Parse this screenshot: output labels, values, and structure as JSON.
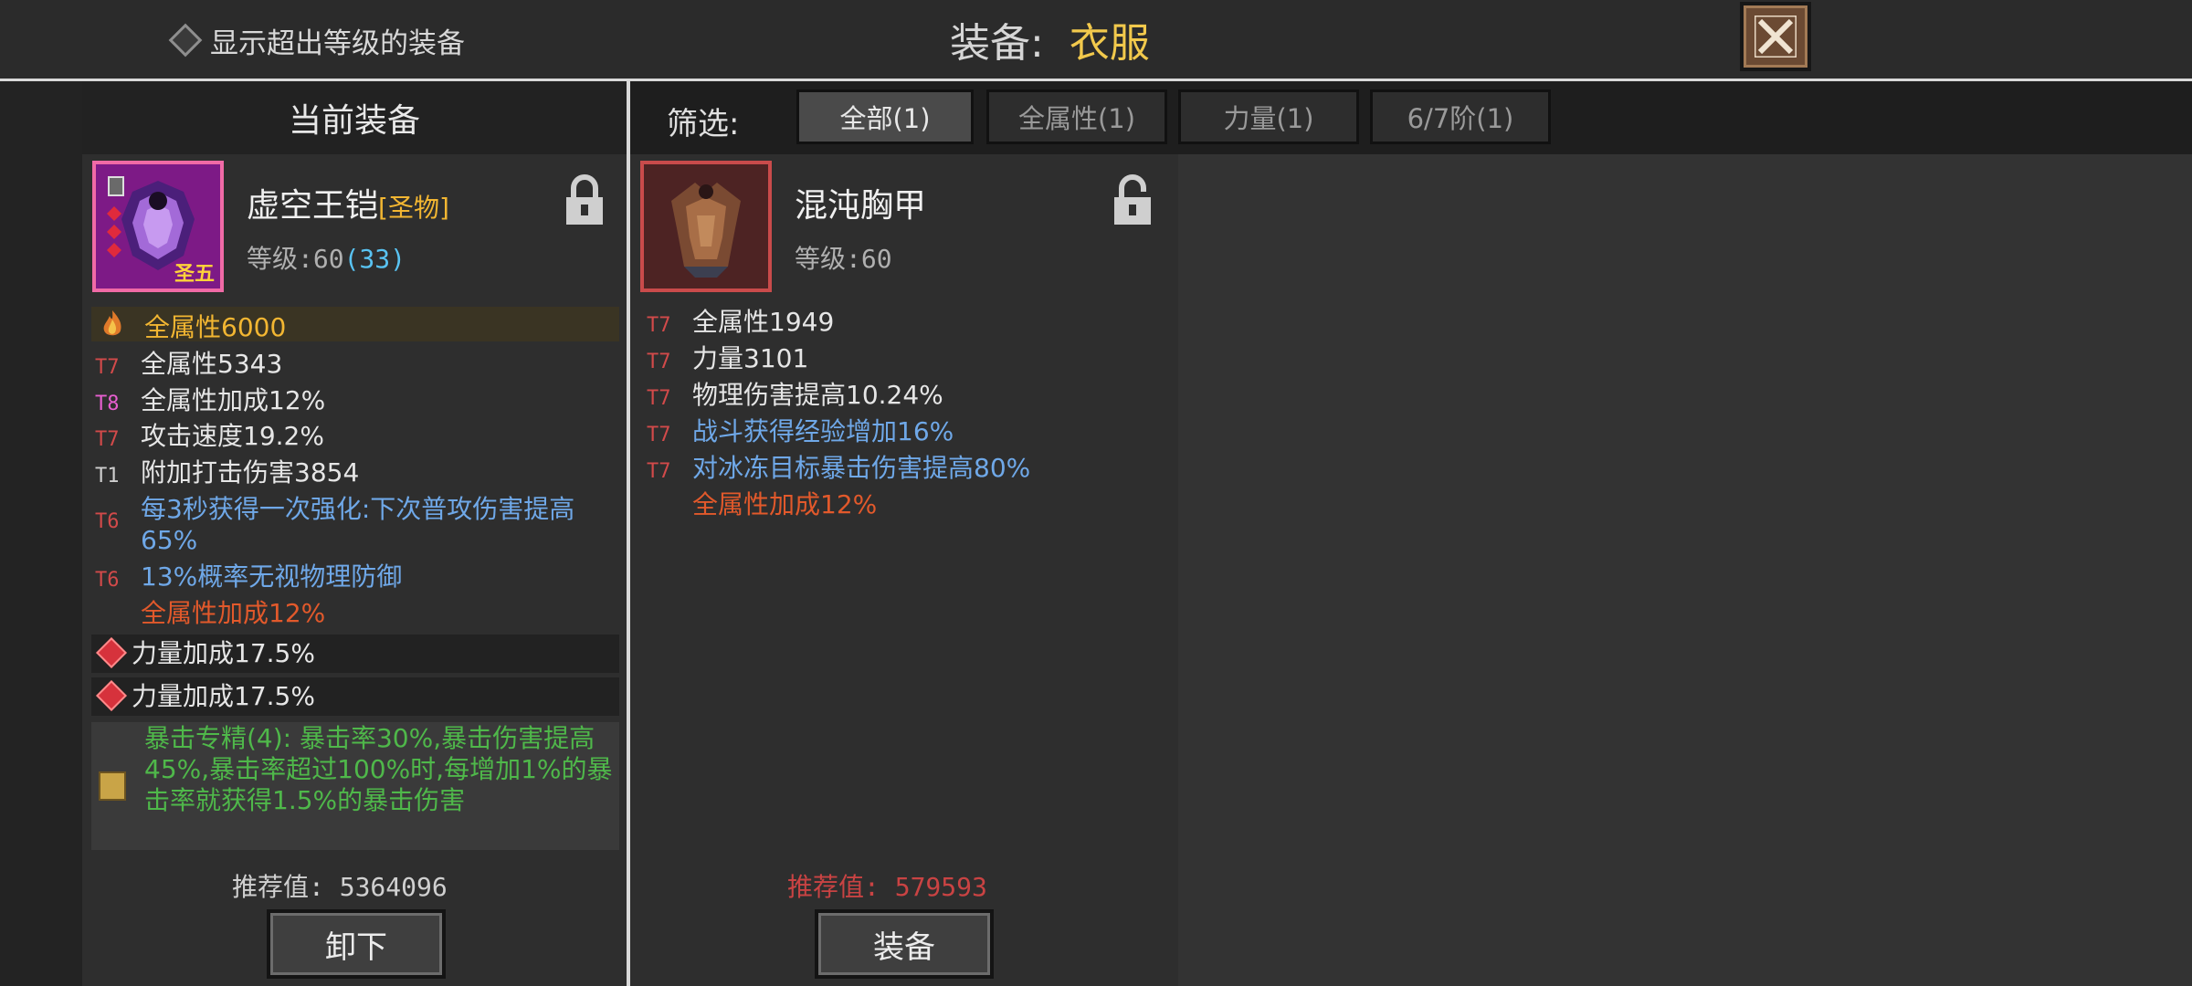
{
  "top": {
    "show_over_level": "显示超出等级的装备",
    "title_label": "装备:",
    "title_slot": "衣服"
  },
  "current": {
    "header": "当前装备",
    "name": "虚空王铠",
    "tag": "[圣物]",
    "badge": "圣五",
    "level_label": "等级:60",
    "level_extra": "(33)",
    "highlight_stat": "全属性6000",
    "stats": [
      {
        "tier": "T7",
        "text": "全属性5343",
        "tier_color": "#d24a4a",
        "color": "#e6e6e6"
      },
      {
        "tier": "T8",
        "text": "全属性加成12%",
        "tier_color": "#e75fd0",
        "color": "#e6e6e6"
      },
      {
        "tier": "T7",
        "text": "攻击速度19.2%",
        "tier_color": "#d24a4a",
        "color": "#e6e6e6"
      },
      {
        "tier": "T1",
        "text": "附加打击伤害3854",
        "tier_color": "#cfcfcf",
        "color": "#e6e6e6"
      },
      {
        "tier": "T6",
        "text": "每3秒获得一次强化:下次普攻伤害提高65%",
        "tier_color": "#d24a4a",
        "color": "#6fa8e8"
      },
      {
        "tier": "T6",
        "text": "13%概率无视物理防御",
        "tier_color": "#d24a4a",
        "color": "#6fa8e8"
      },
      {
        "tier": "",
        "text": "全属性加成12%",
        "tier_color": "#d24a4a",
        "color": "#e2592b"
      }
    ],
    "gems": [
      "力量加成17.5%",
      "力量加成17.5%"
    ],
    "skill": "暴击专精(4): 暴击率30%,暴击伤害提高45%,暴击率超过100%时,每增加1%的暴击率就获得1.5%的暴击伤害",
    "recommend": "推荐值: 5364096",
    "unequip_button": "卸下"
  },
  "filter": {
    "label": "筛选:",
    "tabs": [
      "全部(1)",
      "全属性(1)",
      "力量(1)",
      "6/7阶(1)"
    ]
  },
  "candidate": {
    "name": "混沌胸甲",
    "level_label": "等级:60",
    "stats": [
      {
        "tier": "T7",
        "text": "全属性1949",
        "tier_color": "#d24a4a",
        "color": "#e6e6e6"
      },
      {
        "tier": "T7",
        "text": "力量3101",
        "tier_color": "#d24a4a",
        "color": "#e6e6e6"
      },
      {
        "tier": "T7",
        "text": "物理伤害提高10.24%",
        "tier_color": "#d24a4a",
        "color": "#e6e6e6"
      },
      {
        "tier": "T7",
        "text": "战斗获得经验增加16%",
        "tier_color": "#d24a4a",
        "color": "#6fa8e8"
      },
      {
        "tier": "T7",
        "text": "对冰冻目标暴击伤害提高80%",
        "tier_color": "#d24a4a",
        "color": "#6fa8e8"
      },
      {
        "tier": "",
        "text": "全属性加成12%",
        "tier_color": "#d24a4a",
        "color": "#e2592b"
      }
    ],
    "recommend": "推荐值: 579593",
    "equip_button": "装备"
  }
}
